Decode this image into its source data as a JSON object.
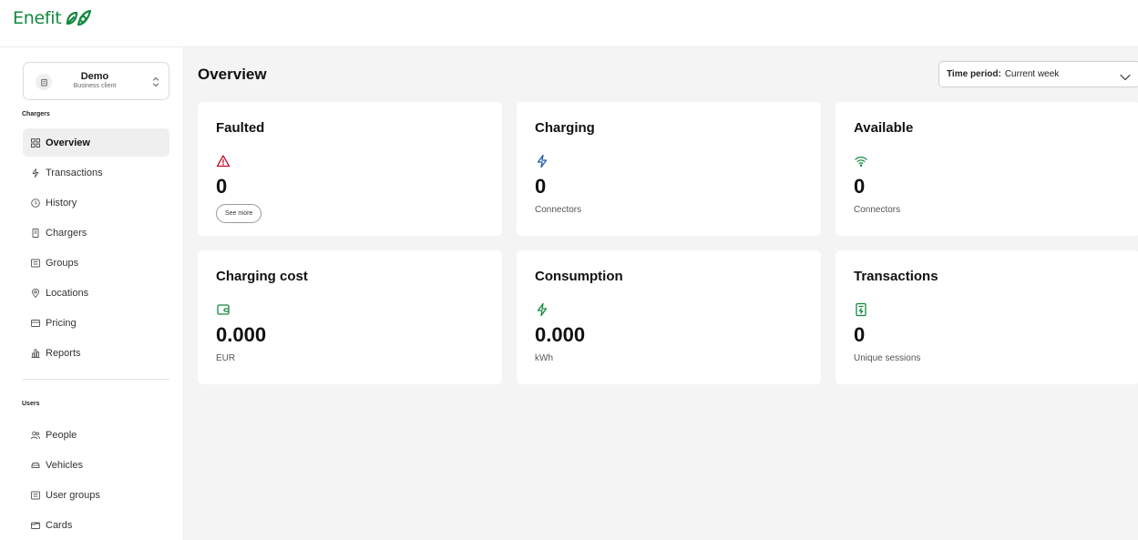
{
  "app": {
    "logo_text": "Enefit"
  },
  "account": {
    "name": "Demo",
    "subtitle": "Business client"
  },
  "sidebar": {
    "chargers_section": "Chargers",
    "chargers_items": [
      {
        "label": "Overview",
        "icon": "grid-icon",
        "active": true
      },
      {
        "label": "Transactions",
        "icon": "bolt-icon"
      },
      {
        "label": "History",
        "icon": "clock-icon"
      },
      {
        "label": "Chargers",
        "icon": "charger-icon"
      },
      {
        "label": "Groups",
        "icon": "groups-icon"
      },
      {
        "label": "Locations",
        "icon": "pin-icon"
      },
      {
        "label": "Pricing",
        "icon": "price-icon"
      },
      {
        "label": "Reports",
        "icon": "reports-icon"
      }
    ],
    "users_section": "Users",
    "users_items": [
      {
        "label": "People",
        "icon": "people-icon"
      },
      {
        "label": "Vehicles",
        "icon": "car-icon"
      },
      {
        "label": "User groups",
        "icon": "user-groups-icon"
      },
      {
        "label": "Cards",
        "icon": "card-icon"
      }
    ]
  },
  "main": {
    "title": "Overview",
    "period": {
      "label": "Time period:",
      "value": "Current week"
    },
    "cards": [
      {
        "title": "Faulted",
        "icon": "warning-icon",
        "value": "0",
        "button": "See more"
      },
      {
        "title": "Charging",
        "icon": "bolt-icon",
        "value": "0",
        "unit": "Connectors"
      },
      {
        "title": "Available",
        "icon": "wifi-icon",
        "value": "0",
        "unit": "Connectors"
      },
      {
        "title": "Charging cost",
        "icon": "wallet-icon",
        "value": "0.000",
        "unit": "EUR"
      },
      {
        "title": "Consumption",
        "icon": "bolt-icon",
        "value": "0.000",
        "unit": "kWh"
      },
      {
        "title": "Transactions",
        "icon": "charger-icon",
        "value": "0",
        "unit": "Unique sessions"
      }
    ]
  },
  "colors": {
    "brand": "#12893e",
    "danger": "#c8102e",
    "info": "#1f5ea8",
    "success": "#12893e",
    "active_bg": "#efefef",
    "main_bg": "#f4f4f4"
  }
}
